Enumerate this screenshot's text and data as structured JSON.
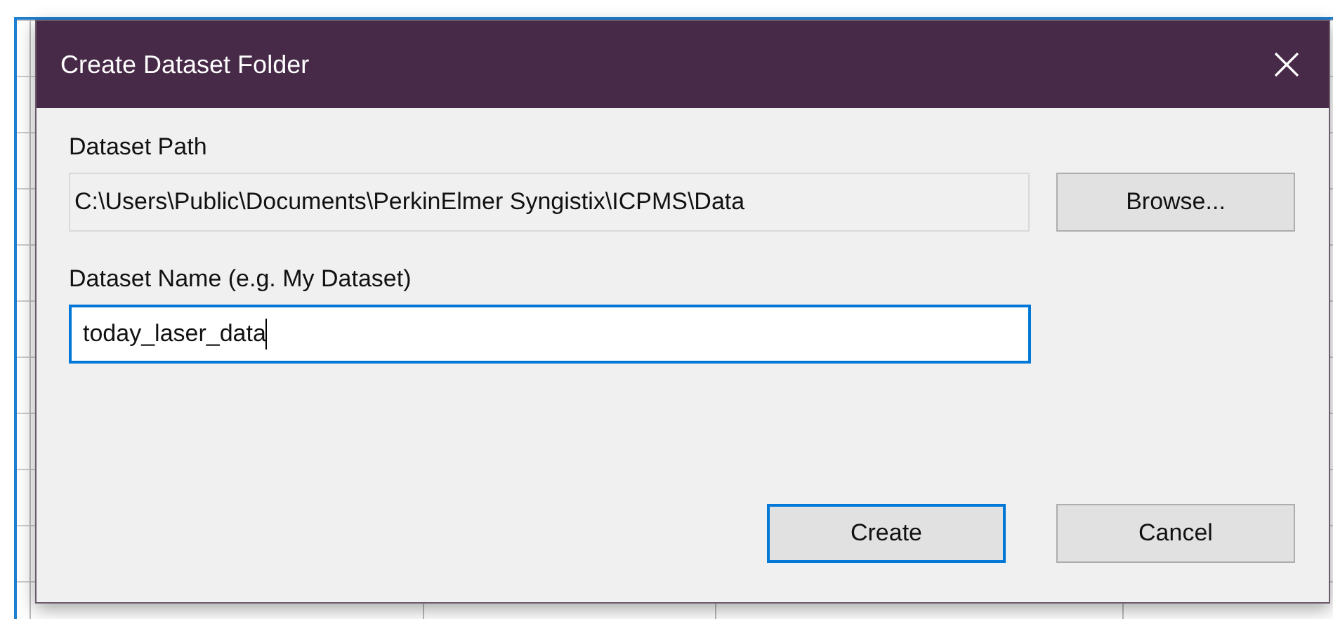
{
  "window": {
    "title": "Create Dataset Folder"
  },
  "fields": [
    {
      "label": "Dataset Path",
      "value": "C:\\Users\\Public\\Documents\\PerkinElmer Syngistix\\ICPMS\\Data",
      "readonly": true,
      "focused": false,
      "button": {
        "label": "Browse...",
        "default": false
      }
    },
    {
      "label": "Dataset Name (e.g. My Dataset)",
      "value": "today_laser_data",
      "readonly": false,
      "focused": true
    }
  ],
  "buttons": [
    {
      "label": "Create",
      "default": true
    },
    {
      "label": "Cancel",
      "default": false
    }
  ]
}
